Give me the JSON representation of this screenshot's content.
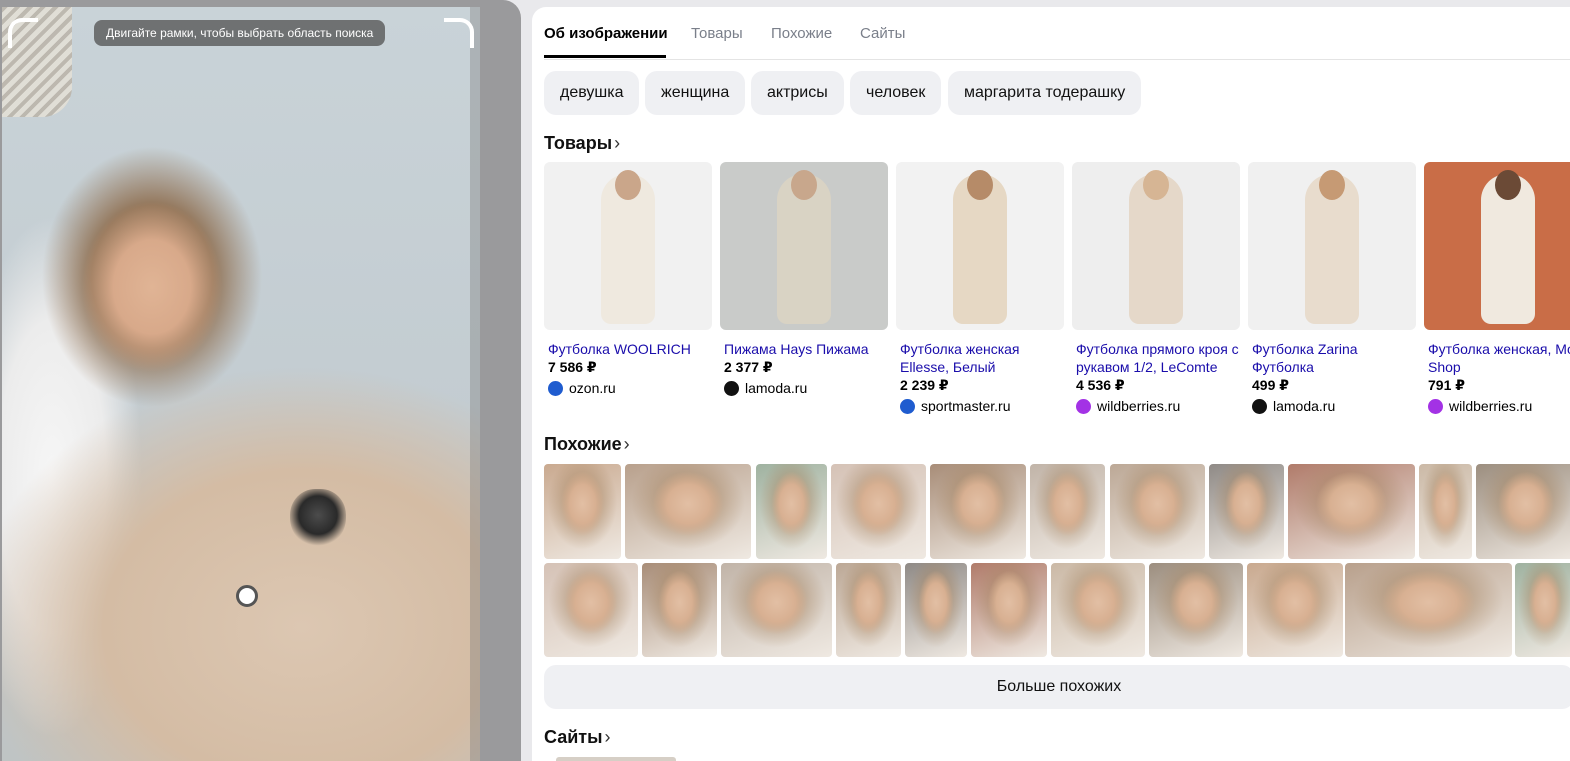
{
  "preview": {
    "hint": "Двигайте рамки, чтобы выбрать область поиска"
  },
  "tabs": [
    {
      "label": "Об изображении",
      "active": true
    },
    {
      "label": "Товары",
      "active": false
    },
    {
      "label": "Похожие",
      "active": false
    },
    {
      "label": "Сайты",
      "active": false
    }
  ],
  "tags": [
    "девушка",
    "женщина",
    "актрисы",
    "человек",
    "маргарита тодерашку"
  ],
  "sections": {
    "products": "Товары",
    "similar": "Похожие",
    "sites": "Сайты"
  },
  "products": [
    {
      "title": "Футболка WOOLRICH",
      "price": "7 586 ₽",
      "store": "ozon.ru",
      "store_icon": "ozon-icon",
      "icon_color": "#1f5ccf"
    },
    {
      "title": "Пижама Hays Пижама",
      "price": "2 377 ₽",
      "store": "lamoda.ru",
      "store_icon": "lamoda-icon",
      "icon_color": "#111111"
    },
    {
      "title": "Футболка женская Ellesse, Белый",
      "price": "2 239 ₽",
      "store": "sportmaster.ru",
      "store_icon": "sportmaster-icon",
      "icon_color": "#1f5ccf"
    },
    {
      "title": "Футболка прямого кроя с рукавом 1/2, LeComte",
      "price": "4 536 ₽",
      "store": "wildberries.ru",
      "store_icon": "wildberries-icon",
      "icon_color": "#a332e5"
    },
    {
      "title": "Футболка Zarina Футболка",
      "price": "499 ₽",
      "store": "lamoda.ru",
      "store_icon": "lamoda-icon",
      "icon_color": "#111111"
    },
    {
      "title": "Футболка женская, Moss Shop",
      "price": "791 ₽",
      "store": "wildberries.ru",
      "store_icon": "wildberries-icon",
      "icon_color": "#a332e5"
    }
  ],
  "more_similar": "Больше похожих"
}
